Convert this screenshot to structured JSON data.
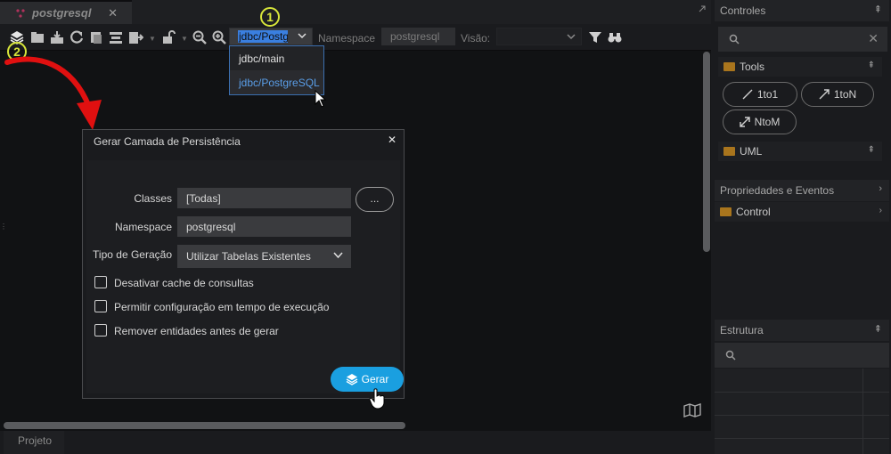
{
  "tab": {
    "title": "postgresql",
    "close": "✕"
  },
  "toolbar": {
    "connection_value": "jdbc/Postg",
    "namespace_label": "Namespace",
    "namespace_value": "postgresql",
    "visao_label": "Visão:",
    "visao_value": ""
  },
  "dropdown": {
    "options": [
      "jdbc/main",
      "jdbc/PostgreSQL"
    ],
    "selected": "jdbc/PostgreSQL"
  },
  "badges": {
    "one": "1",
    "two": "2"
  },
  "dialog": {
    "title": "Gerar Camada de Persistência",
    "close": "✕",
    "classes_label": "Classes",
    "classes_value": "[Todas]",
    "ellipsis": "...",
    "namespace_label": "Namespace",
    "namespace_value": "postgresql",
    "tipo_label": "Tipo de Geração",
    "tipo_value": "Utilizar Tabelas Existentes",
    "checkboxes": [
      {
        "label": "Desativar cache de consultas",
        "checked": false
      },
      {
        "label": "Permitir configuração em tempo de execução",
        "checked": false
      },
      {
        "label": "Remover entidades antes de gerar",
        "checked": false
      }
    ],
    "gerar_label": "Gerar"
  },
  "bottom": {
    "tab_label": "Projeto"
  },
  "right": {
    "controles_title": "Controles",
    "search_clear": "✕",
    "tools_label": "Tools",
    "tools": [
      "1to1",
      "1toN",
      "NtoM"
    ],
    "uml_label": "UML",
    "propriedades_title": "Propriedades e Eventos",
    "control_label": "Control",
    "estrutura_title": "Estrutura"
  },
  "colors": {
    "accent": "#1a9fe0",
    "badge": "#d7e53a",
    "arrow": "#e01010",
    "folder": "#a9751d",
    "selection": "#3a7fe0"
  }
}
